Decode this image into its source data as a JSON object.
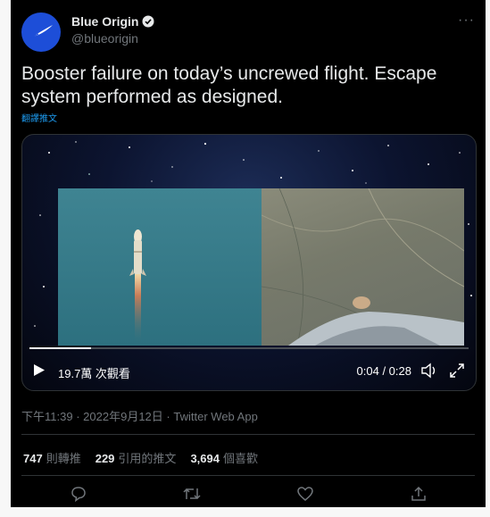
{
  "account": {
    "display_name": "Blue Origin",
    "handle": "@blueorigin",
    "verified": true,
    "avatar_color": "#1d4ed8"
  },
  "menu_icon": "more-icon",
  "tweet": {
    "text": "Booster failure on today’s uncrewed flight. Escape system performed as designed.",
    "translate_label": "翻譯推文"
  },
  "video": {
    "views": "19.7萬 次觀看",
    "timecode": "0:04 / 0:28",
    "progress": 0.14
  },
  "meta": {
    "time": "下午11:39",
    "date": "2022年9月12日",
    "separator": "·",
    "app": "Twitter Web App"
  },
  "stats": [
    {
      "count": "747",
      "label": "則轉推"
    },
    {
      "count": "229",
      "label": "引用的推文"
    },
    {
      "count": "3,694",
      "label": "個喜歡"
    }
  ],
  "colors": {
    "background": "#000000",
    "text": "#e7e9ea",
    "muted": "#71767b",
    "link": "#1d9bf0",
    "border": "#2f3336"
  }
}
